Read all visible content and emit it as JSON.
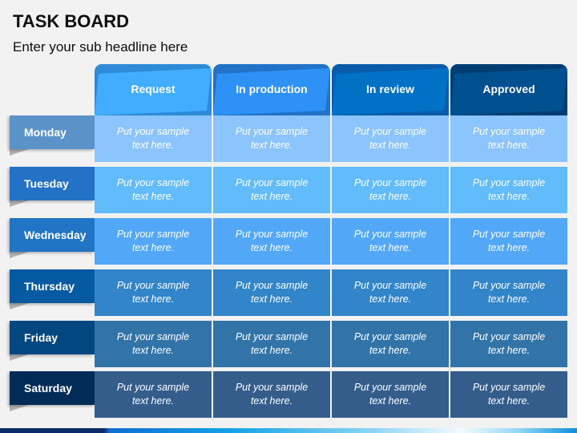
{
  "header": {
    "title": "TASK BOARD",
    "subtitle": "Enter your sub headline here"
  },
  "columns": [
    {
      "label": "Request",
      "base_color": "#2d8bd8",
      "face_color": "#42adff"
    },
    {
      "label": "In production",
      "base_color": "#2272c8",
      "face_color": "#2d91f5"
    },
    {
      "label": "In review",
      "base_color": "#0a5ba9",
      "face_color": "#0071c5"
    },
    {
      "label": "Approved",
      "base_color": "#003d73",
      "face_color": "#00508f"
    }
  ],
  "rows": [
    {
      "day": "Monday",
      "label_color": "#5b93c8",
      "cell_color": "#8cc4fd",
      "cells": [
        "Put your sample text here.",
        "Put your sample text here.",
        "Put your sample text here.",
        "Put your sample text here."
      ]
    },
    {
      "day": "Tuesday",
      "label_color": "#2372c6",
      "cell_color": "#62bbfb",
      "cells": [
        "Put your sample text here.",
        "Put your sample text here.",
        "Put your sample text here.",
        "Put your sample text here."
      ]
    },
    {
      "day": "Wednesday",
      "label_color": "#2274c5",
      "cell_color": "#52a7f7",
      "cells": [
        "Put your sample text here.",
        "Put your sample text here.",
        "Put your sample text here.",
        "Put your sample text here."
      ]
    },
    {
      "day": "Thursday",
      "label_color": "#065aa1",
      "cell_color": "#3285c9",
      "cells": [
        "Put your sample text here.",
        "Put your sample text here.",
        "Put your sample text here.",
        "Put your sample text here."
      ]
    },
    {
      "day": "Friday",
      "label_color": "#034780",
      "cell_color": "#3274a8",
      "cells": [
        "Put your sample text here.",
        "Put your sample text here.",
        "Put your sample text here.",
        "Put your sample text here."
      ]
    },
    {
      "day": "Saturday",
      "label_color": "#022c58",
      "cell_color": "#345d8c",
      "cells": [
        "Put your sample text here.",
        "Put your sample text here.",
        "Put your sample text here.",
        "Put your sample text here."
      ]
    }
  ]
}
